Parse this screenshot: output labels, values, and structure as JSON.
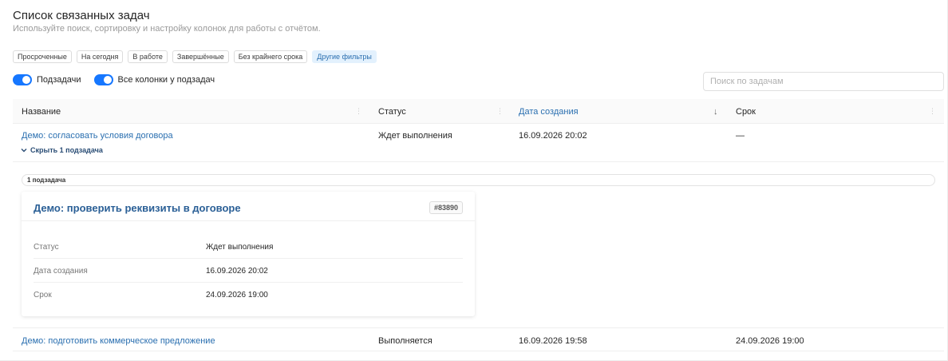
{
  "header": {
    "title": "Список связанных задач",
    "subtitle": "Используйте поиск, сортировку и настройку колонок для работы с отчётом."
  },
  "filters": [
    {
      "label": "Просроченные"
    },
    {
      "label": "На сегодня"
    },
    {
      "label": "В работе"
    },
    {
      "label": "Завершённые"
    },
    {
      "label": "Без крайнего срока"
    },
    {
      "label": "Другие фильтры",
      "accent": true
    }
  ],
  "toggles": {
    "subtasks": {
      "label": "Подзадачи",
      "on": true
    },
    "all_columns": {
      "label": "Все колонки у подзадач",
      "on": true
    }
  },
  "search": {
    "placeholder": "Поиск по задачам",
    "value": ""
  },
  "columns": {
    "name": "Название",
    "status": "Статус",
    "created": "Дата создания",
    "due": "Срок",
    "sort_indicator": "↓"
  },
  "rows": [
    {
      "name": "Демо: согласовать условия договора",
      "status": "Ждет выполнения",
      "created": "16.09.2026 20:02",
      "due": "—",
      "expander": "Скрыть 1 подзадача"
    },
    {
      "name": "Демо: подготовить коммерческое предложение",
      "status": "Выполняется",
      "created": "16.09.2026 19:58",
      "due": "24.09.2026 19:00"
    }
  ],
  "subtasks": {
    "count_label": "1 подзадача",
    "card": {
      "title": "Демо: проверить реквизиты в договоре",
      "id": "#83890",
      "fields": [
        {
          "key": "Статус",
          "value": "Ждет выполнения"
        },
        {
          "key": "Дата создания",
          "value": "16.09.2026 20:02"
        },
        {
          "key": "Срок",
          "value": "24.09.2026 19:00"
        }
      ]
    }
  },
  "colors": {
    "accent": "#1677ff",
    "link": "#2a6fb0",
    "chip_accent_bg": "#e3f1fd"
  }
}
